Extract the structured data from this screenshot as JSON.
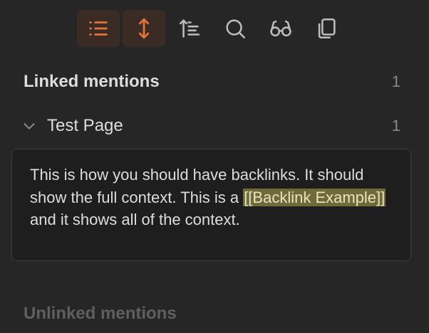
{
  "toolbar": {
    "buttons": [
      {
        "icon": "list-icon",
        "active": true
      },
      {
        "icon": "expand-vertical-icon",
        "active": true
      },
      {
        "icon": "sort-icon",
        "active": false
      },
      {
        "icon": "search-icon",
        "active": false
      },
      {
        "icon": "glasses-icon",
        "active": false
      },
      {
        "icon": "copy-icon",
        "active": false
      }
    ],
    "accent_color": "#e2743c",
    "icon_color": "#bcbcbc"
  },
  "linked_mentions": {
    "title": "Linked mentions",
    "count": "1",
    "files": [
      {
        "title": "Test Page",
        "count": "1",
        "snippet": {
          "before": "This is how you should have backlinks. It should show the full context. This is a ",
          "link": "[[Backlink Example]]",
          "after": " and it shows all of the context."
        }
      }
    ]
  },
  "unlinked_mentions": {
    "title": "Unlinked mentions"
  }
}
